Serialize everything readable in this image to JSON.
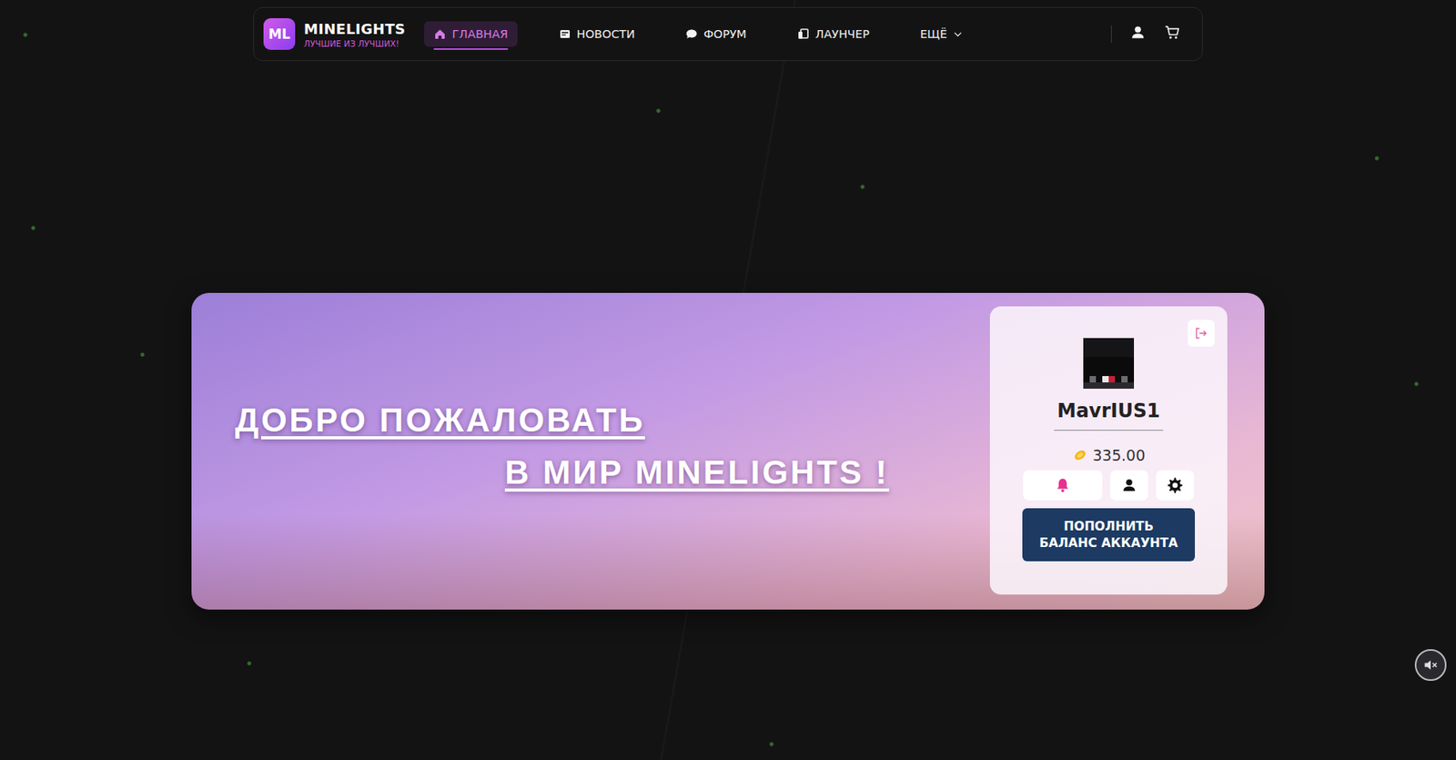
{
  "brand": {
    "logo": "ML",
    "title": "MINELIGHTS",
    "subtitle": "ЛУЧШИЕ ИЗ ЛУЧШИХ!"
  },
  "nav": [
    {
      "label": "ГЛАВНАЯ",
      "icon": "home",
      "selected": true
    },
    {
      "label": "НОВОСТИ",
      "icon": "news",
      "selected": false
    },
    {
      "label": "ФОРУМ",
      "icon": "chat",
      "selected": false
    },
    {
      "label": "ЛАУНЧЕР",
      "icon": "launcher",
      "selected": false
    },
    {
      "label": "ЕЩЁ",
      "icon": "chevron",
      "selected": false
    }
  ],
  "hero": {
    "line1": "ДОБРО ПОЖАЛОВАТЬ",
    "line2": "В МИР MINELIGHTS !"
  },
  "profile": {
    "username": "MavrIUS1",
    "balance": "335.00",
    "tools": [
      {
        "icon": "bell",
        "selected": true
      },
      {
        "icon": "user",
        "selected": false
      },
      {
        "icon": "gear",
        "selected": false
      }
    ],
    "topup": [
      "ПОПОЛНИТЬ",
      "БАЛАНС АККАУНТА"
    ]
  },
  "mute": {
    "muted": true
  }
}
